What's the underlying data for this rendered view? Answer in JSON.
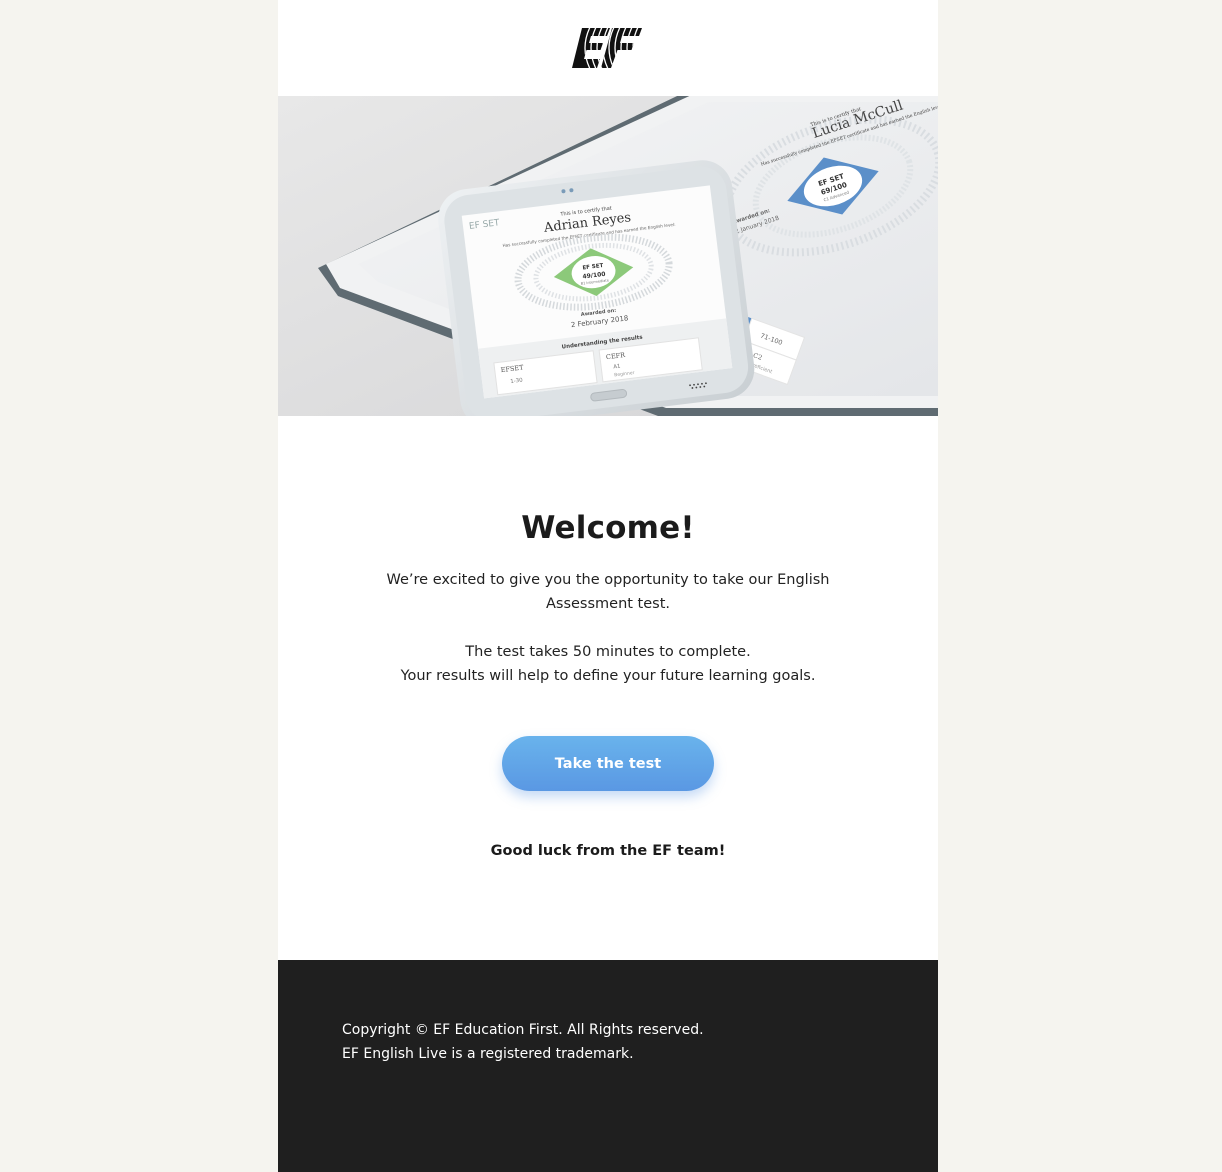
{
  "brand": {
    "logo_icon": "ef-logo-icon"
  },
  "hero": {
    "phone": {
      "certify": "This is to certify that",
      "name": "Adrian Reyes",
      "desc": "Has successfully completed the EFSET certificate and has earned the English level:",
      "badge_title": "EF SET",
      "badge_score": "49/100",
      "badge_level": "B1 Intermediate",
      "awarded_label": "Awarded on:",
      "awarded_date": "2 February 2018",
      "results_heading": "Understanding the results",
      "col1_head": "EFSET",
      "col2_head": "CEFR",
      "col1_val": "1-30",
      "col2_val": "A1",
      "col2_sub": "Beginner",
      "logo": "EF SET"
    },
    "tablet": {
      "certify": "This is to certify that",
      "name": "Lucia McCull",
      "desc": "Has successfully completed the EFSET certificate and has earned the English level:",
      "badge_title": "EF SET",
      "badge_score": "69/100",
      "badge_level": "C1 Advanced",
      "awarded_label": "Awarded on:",
      "awarded_date": "12 January 2018",
      "cell1": "71-100",
      "cell2": "C2",
      "cell3": "Proficient"
    }
  },
  "content": {
    "title": "Welcome!",
    "intro": "We’re excited to give you the opportunity to take our English Assessment test.",
    "duration": "The test takes 50 minutes to complete.",
    "goals": "Your results will help to define your future learning goals.",
    "cta_label": "Take the test",
    "signoff": "Good luck from the EF team!"
  },
  "footer": {
    "copyright": "Copyright © EF Education First. All Rights reserved. EF English Live is a registered trademark."
  },
  "colors": {
    "page_bg": "#f5f4ef",
    "cta_top": "#69b3ec",
    "cta_bottom": "#5a98e3",
    "footer_bg": "#1f1f1f",
    "badge_green": "#8cc97a",
    "badge_blue": "#5b8fc9"
  }
}
